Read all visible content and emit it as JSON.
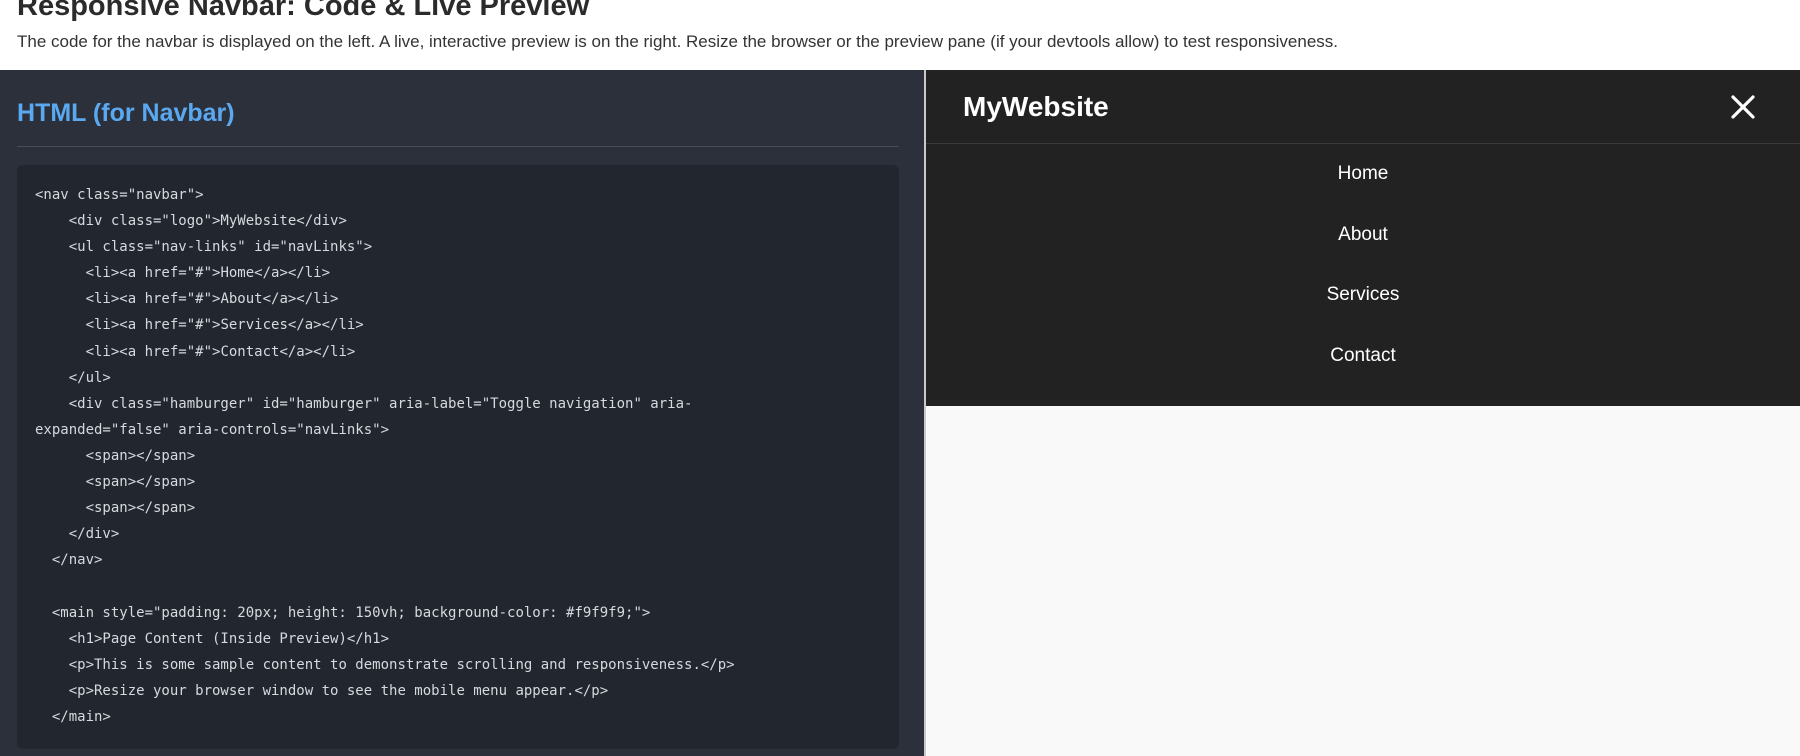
{
  "header": {
    "title": "Responsive Navbar: Code & Live Preview",
    "subtitle": "The code for the navbar is displayed on the left. A live, interactive preview is on the right. Resize the browser or the preview pane (if your devtools allow) to test responsiveness."
  },
  "code_panel": {
    "heading": "HTML (for Navbar)",
    "code": "<nav class=\"navbar\">\n    <div class=\"logo\">MyWebsite</div>\n    <ul class=\"nav-links\" id=\"navLinks\">\n      <li><a href=\"#\">Home</a></li>\n      <li><a href=\"#\">About</a></li>\n      <li><a href=\"#\">Services</a></li>\n      <li><a href=\"#\">Contact</a></li>\n    </ul>\n    <div class=\"hamburger\" id=\"hamburger\" aria-label=\"Toggle navigation\" aria-\nexpanded=\"false\" aria-controls=\"navLinks\">\n      <span></span>\n      <span></span>\n      <span></span>\n    </div>\n  </nav>\n\n  <main style=\"padding: 20px; height: 150vh; background-color: #f9f9f9;\">\n    <h1>Page Content (Inside Preview)</h1>\n    <p>This is some sample content to demonstrate scrolling and responsiveness.</p>\n    <p>Resize your browser window to see the mobile menu appear.</p>\n  </main>"
  },
  "preview": {
    "logo": "MyWebsite",
    "close_icon": "close-x-icon",
    "nav_links": [
      "Home",
      "About",
      "Services",
      "Contact"
    ]
  },
  "colors": {
    "code_pane_bg": "#2b303b",
    "code_block_bg": "#22262e",
    "heading_accent": "#5aa9f0",
    "navbar_bg": "#222222",
    "preview_bg": "#f9f9f9"
  }
}
